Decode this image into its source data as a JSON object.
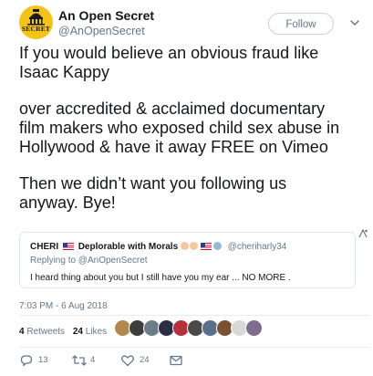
{
  "account": {
    "display_name": "An Open Secret",
    "handle": "@AnOpenSecret",
    "avatar_text": "SECRET"
  },
  "follow_button": {
    "label": "Follow"
  },
  "tweet": {
    "paragraphs": [
      "If you would believe an obvious fraud like",
      "Isaac Kappy",
      "over accredited & acclaimed documentary",
      "film makers who exposed child sex abuse in",
      "Hollywood & have it away FREE on Vimeo",
      "Then we didn’t want you following us",
      "anyway. Bye!"
    ]
  },
  "quoted_reply": {
    "name": "CHERI",
    "name_suffix": "Deplorable with Morals",
    "handle": "@cheriharly34",
    "replying_to": "Replying to @AnOpenSecret",
    "text": "I heard thing about you but I still have you my ear ... NO MORE ."
  },
  "timestamp": "7:03 PM - 6 Aug 2018",
  "stats": {
    "retweets_count": "4",
    "retweets_label": "Retweets",
    "likes_count": "24",
    "likes_label": "Likes"
  },
  "likers": [
    {
      "icon": "liker-avatar-1",
      "color": "#b08850"
    },
    {
      "icon": "liker-avatar-2",
      "color": "#3d3d3d"
    },
    {
      "icon": "liker-avatar-3",
      "color": "#6d7b8a"
    },
    {
      "icon": "liker-avatar-4",
      "color": "#2a2f45"
    },
    {
      "icon": "liker-avatar-5",
      "color": "#b3323f"
    },
    {
      "icon": "liker-avatar-6",
      "color": "#4a4a4a"
    },
    {
      "icon": "liker-avatar-7",
      "color": "#5a6f8c"
    },
    {
      "icon": "liker-avatar-8",
      "color": "#7a5230"
    },
    {
      "icon": "liker-avatar-9",
      "color": "#d9d9d9"
    },
    {
      "icon": "liker-avatar-10",
      "color": "#7f6c8f"
    }
  ],
  "actions": {
    "replies": "13",
    "retweets": "4",
    "likes": "24"
  },
  "colors": {
    "text": "#14171a",
    "secondary": "#657786",
    "border": "#e1e8ed",
    "avatar_bg": "#f2c318"
  }
}
